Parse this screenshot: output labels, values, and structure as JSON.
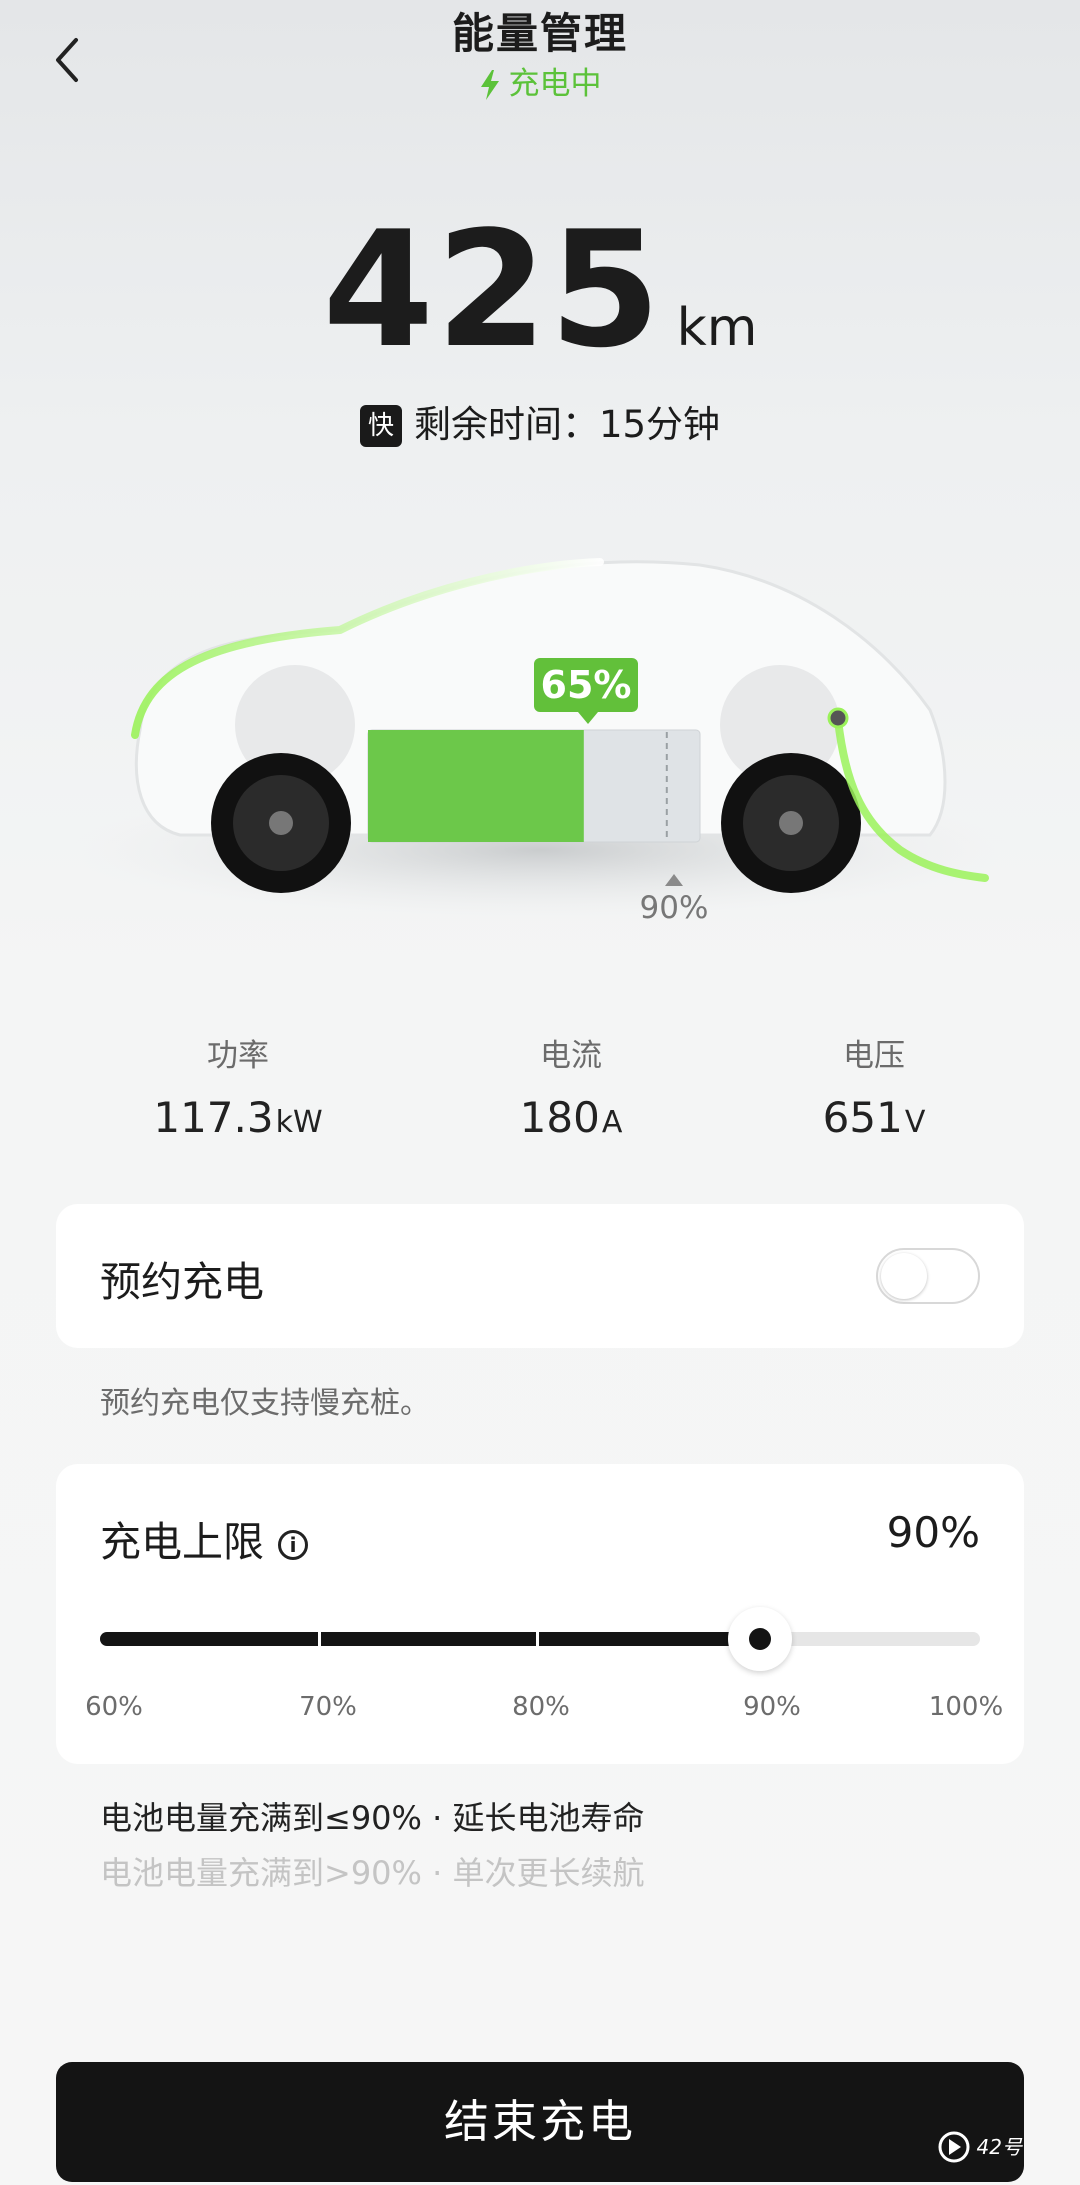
{
  "header": {
    "title": "能量管理",
    "status": "充电中"
  },
  "range": {
    "value": "425",
    "unit": "km"
  },
  "remaining": {
    "badge": "快",
    "text": "剩余时间：15分钟"
  },
  "battery": {
    "soc_label": "65%",
    "soc": 0.65,
    "limit_label": "90%",
    "limit": 0.9
  },
  "stats": [
    {
      "label": "功率",
      "value": "117.3",
      "unit": "kW"
    },
    {
      "label": "电流",
      "value": "180",
      "unit": "A"
    },
    {
      "label": "电压",
      "value": "651",
      "unit": "V"
    }
  ],
  "schedule": {
    "label": "预约充电",
    "enabled": false,
    "note": "预约充电仅支持慢充桩。"
  },
  "charge_limit": {
    "label": "充电上限",
    "value": "90%",
    "slider_value": 0.75,
    "ticks": [
      "60%",
      "70%",
      "80%",
      "90%",
      "100%"
    ],
    "hint_active": "电池电量充满到≤90%  ·  延长电池寿命",
    "hint_inactive": "电池电量充满到>90%  ·  单次更长续航"
  },
  "end_button": "结束充电",
  "watermark": "42号",
  "colors": {
    "accent": "#62c03a",
    "dark": "#141414"
  }
}
